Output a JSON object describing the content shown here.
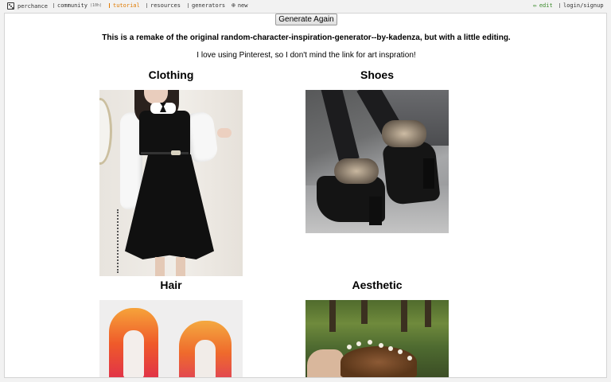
{
  "nav": {
    "site": "perchance",
    "community": "community",
    "community_count": "(10h)",
    "tutorial": "tutorial",
    "resources": "resources",
    "generators": "generators",
    "new": "new",
    "edit": "edit",
    "login": "login/signup"
  },
  "page": {
    "generate_button": "Generate Again",
    "intro_bold": "This is a remake of the original random-character-inspiration-generator--by-kadenza, but with a little editing.",
    "intro_normal": "I love using Pinterest, so I don't mind the link for art inspration!"
  },
  "sections": {
    "clothing": "Clothing",
    "shoes": "Shoes",
    "hair": "Hair",
    "aesthetic": "Aesthetic"
  },
  "icons": {
    "logo": "dice-icon",
    "new": "plus-circle-icon",
    "edit": "pencil-icon"
  },
  "colors": {
    "tutorial": "#e07a00",
    "edit": "#3a8a2a"
  }
}
